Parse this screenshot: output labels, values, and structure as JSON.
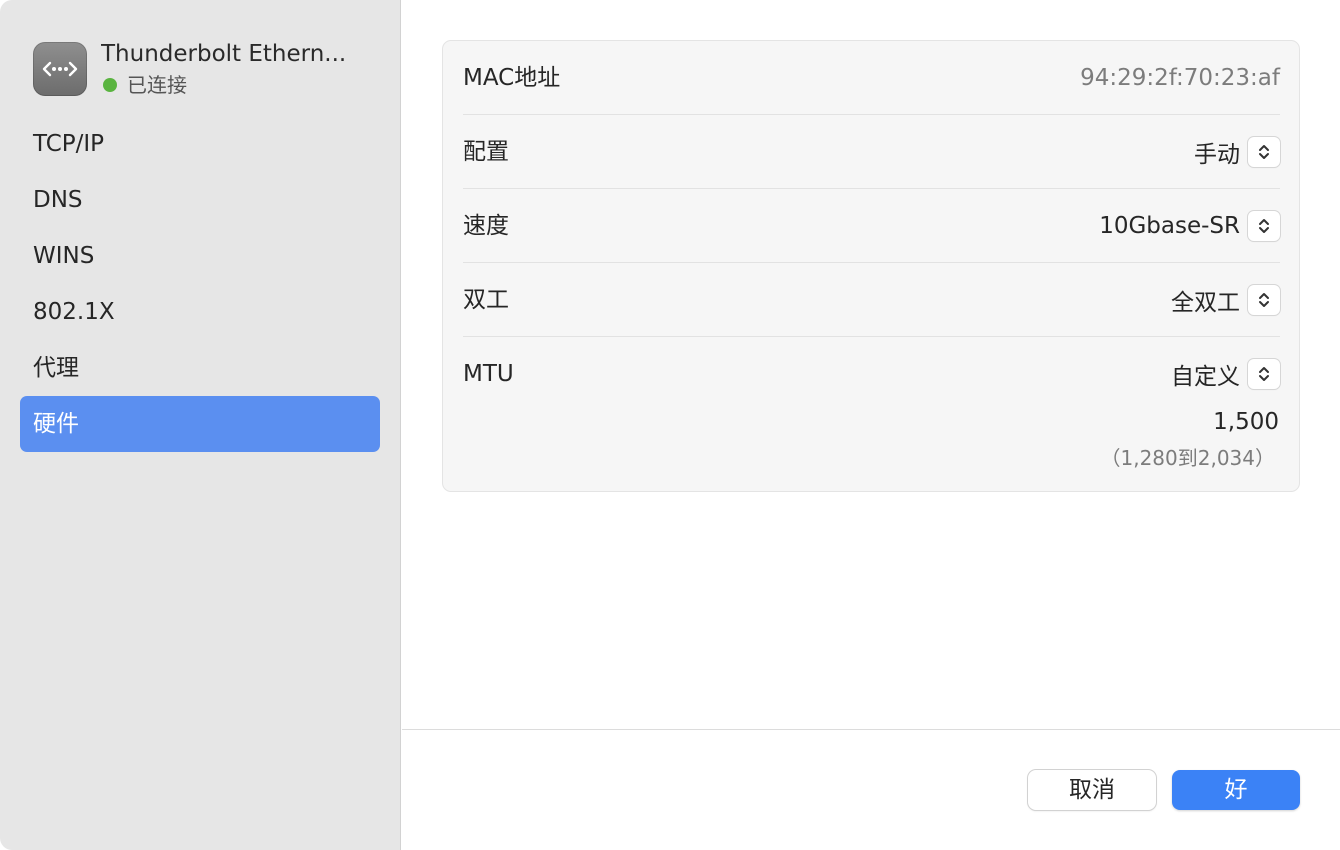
{
  "device": {
    "name": "Thunderbolt Ethern...",
    "status": "已连接",
    "status_color": "#5ab440",
    "icon": "ethernet-icon"
  },
  "sidebar": {
    "items": [
      {
        "label": "TCP/IP"
      },
      {
        "label": "DNS"
      },
      {
        "label": "WINS"
      },
      {
        "label": "802.1X"
      },
      {
        "label": "代理"
      },
      {
        "label": "硬件"
      }
    ],
    "active_index": 5,
    "active_color": "#5b8ff0"
  },
  "hardware": {
    "mac_label": "MAC地址",
    "mac_value": "94:29:2f:70:23:af",
    "config_label": "配置",
    "config_value": "手动",
    "speed_label": "速度",
    "speed_value": "10Gbase-SR",
    "duplex_label": "双工",
    "duplex_value": "全双工",
    "mtu_label": "MTU",
    "mtu_value": "自定义",
    "mtu_number": "1,500",
    "mtu_range": "（1,280到2,034）"
  },
  "footer": {
    "cancel_label": "取消",
    "ok_label": "好",
    "ok_color": "#3b82f6"
  }
}
